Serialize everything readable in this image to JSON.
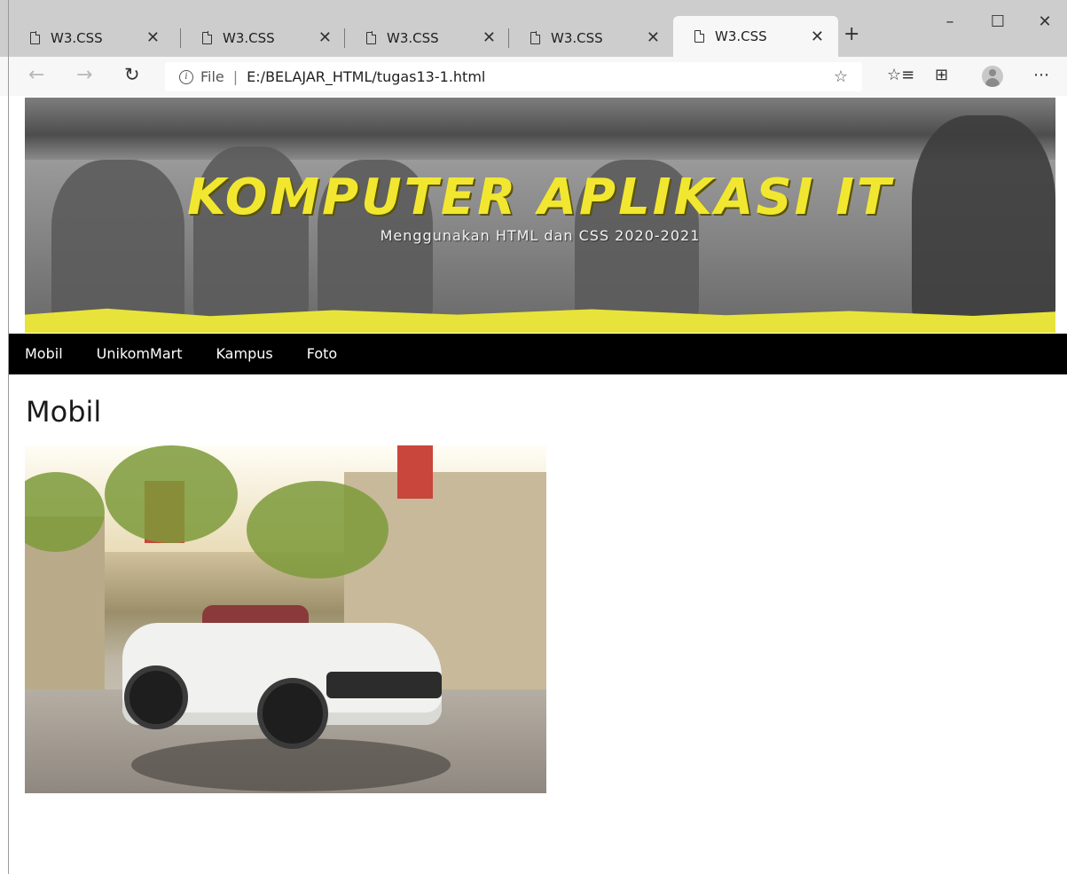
{
  "browser": {
    "tabs": [
      {
        "title": "W3.CSS",
        "active": false
      },
      {
        "title": "W3.CSS",
        "active": false
      },
      {
        "title": "W3.CSS",
        "active": false
      },
      {
        "title": "W3.CSS",
        "active": false
      },
      {
        "title": "W3.CSS",
        "active": true
      }
    ],
    "address": {
      "scheme_label": "File",
      "url": "E:/BELAJAR_HTML/tugas13-1.html"
    },
    "icons": [
      "back-icon",
      "forward-icon",
      "refresh-icon",
      "info-icon",
      "favorite-star-icon",
      "favorites-list-icon",
      "collections-icon",
      "profile-avatar-icon",
      "more-menu-icon",
      "minimize-icon",
      "maximize-icon",
      "close-window-icon"
    ]
  },
  "page": {
    "banner": {
      "title": "KOMPUTER APLIKASI IT",
      "subtitle": "Menggunakan HTML dan CSS 2020-2021"
    },
    "nav": [
      "Mobil",
      "UnikomMart",
      "Kampus",
      "Foto"
    ],
    "heading": "Mobil",
    "colors": {
      "banner_title": "#f2e730",
      "navbar_bg": "#000000",
      "navbar_text": "#ffffff"
    }
  }
}
